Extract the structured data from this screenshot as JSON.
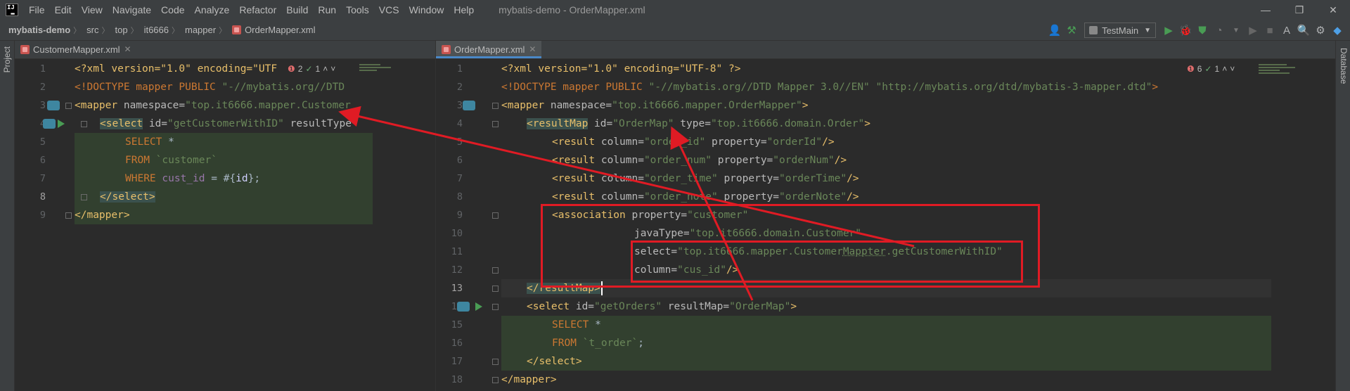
{
  "menubar": {
    "items": [
      "File",
      "Edit",
      "View",
      "Navigate",
      "Code",
      "Analyze",
      "Refactor",
      "Build",
      "Run",
      "Tools",
      "VCS",
      "Window",
      "Help"
    ],
    "title": "mybatis-demo - OrderMapper.xml",
    "minimize": "—",
    "restore": "❐",
    "close": "✕"
  },
  "navbar": {
    "crumbs": [
      "mybatis-demo",
      "src",
      "top",
      "it6666",
      "mapper",
      "OrderMapper.xml"
    ],
    "run_config": "TestMain"
  },
  "side": {
    "project": "Project",
    "database": "Database"
  },
  "left_editor": {
    "tab": "CustomerMapper.xml",
    "errors": "2",
    "ok": "1",
    "lines": [
      {
        "n": "1"
      },
      {
        "n": "2"
      },
      {
        "n": "3"
      },
      {
        "n": "4"
      },
      {
        "n": "5"
      },
      {
        "n": "6"
      },
      {
        "n": "7"
      },
      {
        "n": "8"
      },
      {
        "n": "9"
      }
    ],
    "code": {
      "l1_pi": "<?xml version=\"1.0\" encoding=\"UTF",
      "l2_doc": "<!DOCTYPE mapper PUBLIC ",
      "l2_str": "\"-//mybatis.org//DTD",
      "l3_tag": "<mapper",
      "l3_attr": " namespace=",
      "l3_val": "\"top.it6666.mapper.Customer",
      "l4_tag": "<select",
      "l4_attr": " id=",
      "l4_val": "\"getCustomerWithID\"",
      "l4_attr2": " resultType",
      "l5_sql": "SELECT ",
      "l5_star": "*",
      "l6_sql": "FROM ",
      "l6_tbl": "`customer`",
      "l7_sql": "WHERE ",
      "l7_col": "cust_id",
      "l7_plain": " = #{",
      "l7_var": "id",
      "l7_end": "};",
      "l8_tag": "</select>",
      "l9_tag": "</mapper>"
    }
  },
  "right_editor": {
    "tab": "OrderMapper.xml",
    "errors": "6",
    "ok": "1",
    "code": {
      "l1": "<?xml version=\"1.0\" encoding=\"UTF-8\" ?>",
      "l2_doc": "<!DOCTYPE mapper PUBLIC ",
      "l2_s1": "\"-//mybatis.org//DTD Mapper 3.0//EN\"",
      "l2_s2": " \"http://mybatis.org/dtd/mybatis-3-mapper.dtd\"",
      "l2_end": ">",
      "l3_tag": "<mapper",
      "l3_attr": " namespace=",
      "l3_val": "\"top.it6666.mapper.OrderMapper\"",
      "l3_end": ">",
      "l4_tag": "<resultMap",
      "l4_attr": " id=",
      "l4_val": "\"OrderMap\"",
      "l4_attr2": " type=",
      "l4_val2": "\"top.it6666.domain.Order\"",
      "l4_end": ">",
      "l5_tag": "<result",
      "l5_attr": " column=",
      "l5_val": "\"order_id\"",
      "l5_attr2": " property=",
      "l5_val2": "\"orderId\"",
      "l5_end": "/>",
      "l6_val": "\"order_num\"",
      "l6_val2": "\"orderNum\"",
      "l7_val": "\"order_time\"",
      "l7_val2": "\"orderTime\"",
      "l8_val": "\"order_note\"",
      "l8_val2": "\"orderNote\"",
      "l9_tag": "<association",
      "l9_attr": " property=",
      "l9_val": "\"customer\"",
      "l10_attr": "javaType=",
      "l10_val": "\"top.it6666.domain.Customer\"",
      "l11_attr": "select=",
      "l11_val_a": "\"top.it6666.mapper.Customer",
      "l11_val_b": "Mappter",
      "l11_val_c": ".getCustomerWithID\"",
      "l12_attr": "column=",
      "l12_val": "\"cus_id\"",
      "l12_end": "/>",
      "l13_tag": "</resultMap>",
      "l14_tag": "<select",
      "l14_attr": " id=",
      "l14_val": "\"getOrders\"",
      "l14_attr2": " resultMap=",
      "l14_val2": "\"OrderMap\"",
      "l14_end": ">",
      "l15_sql": "SELECT ",
      "l15_star": "*",
      "l16_sql": "FROM ",
      "l16_tbl": "`t_order`",
      "l16_end": ";",
      "l17_tag": "</select>",
      "l18_tag": "</mapper>"
    },
    "line_numbers": [
      "1",
      "2",
      "3",
      "4",
      "5",
      "6",
      "7",
      "8",
      "9",
      "10",
      "11",
      "12",
      "13",
      "14",
      "15",
      "16",
      "17",
      "18"
    ]
  },
  "colors": {
    "accent": "#4a88c7",
    "annotation": "#e01b24",
    "run": "#499c54"
  }
}
